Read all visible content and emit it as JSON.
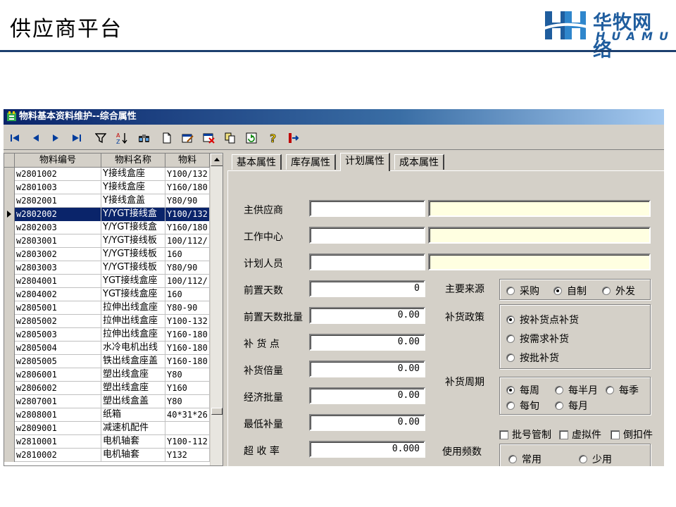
{
  "slide": {
    "title": "供应商平台"
  },
  "logo": {
    "cn": "华牧网络",
    "en": "HUAMU"
  },
  "window": {
    "title": "物料基本资料维护--综合属性",
    "toolbar": [
      "first-record-icon",
      "prev-record-icon",
      "next-record-icon",
      "last-record-icon",
      "filter-icon",
      "sort-icon",
      "find-icon",
      "new-icon",
      "edit-icon",
      "delete-icon",
      "copy-icon",
      "refresh-icon",
      "help-icon",
      "exit-icon"
    ]
  },
  "grid": {
    "columns": [
      "物料编号",
      "物料名称",
      "物料"
    ],
    "selected_index": 3,
    "rows": [
      [
        "w2801002",
        "Y接线盒座",
        "Y100/132"
      ],
      [
        "w2801003",
        "Y接线盒座",
        "Y160/180"
      ],
      [
        "w2802001",
        "Y接线盒盖",
        "Y80/90"
      ],
      [
        "w2802002",
        "Y/YGT接线盒",
        "Y100/132"
      ],
      [
        "w2802003",
        "Y/YGT接线盒",
        "Y160/180"
      ],
      [
        "w2803001",
        "Y/YGT接线板",
        "100/112/"
      ],
      [
        "w2803002",
        "Y/YGT接线板",
        "160"
      ],
      [
        "w2803003",
        "Y/YGT接线板",
        "Y80/90"
      ],
      [
        "w2804001",
        "YGT接线盒座",
        "100/112/"
      ],
      [
        "w2804002",
        "YGT接线盒座",
        "160"
      ],
      [
        "w2805001",
        "拉伸出线盒座",
        "Y80-90"
      ],
      [
        "w2805002",
        "拉伸出线盒座",
        "Y100-132"
      ],
      [
        "w2805003",
        "拉伸出线盒座",
        "Y160-180"
      ],
      [
        "w2805004",
        "水冷电机出线",
        "Y160-180"
      ],
      [
        "w2805005",
        "铁出线盒座盖",
        "Y160-180"
      ],
      [
        "w2806001",
        "塑出线盒座",
        "Y80"
      ],
      [
        "w2806002",
        "塑出线盒座",
        "Y160"
      ],
      [
        "w2807001",
        "塑出线盒盖",
        "Y80"
      ],
      [
        "w2808001",
        "纸箱",
        "40*31*26"
      ],
      [
        "w2809001",
        "减速机配件",
        ""
      ],
      [
        "w2810001",
        "电机轴套",
        "Y100-112"
      ],
      [
        "w2810002",
        "电机轴套",
        "Y132"
      ]
    ]
  },
  "tabs": [
    "基本属性",
    "库存属性",
    "计划属性",
    "成本属性"
  ],
  "active_tab": "计划属性",
  "form": {
    "main_supplier": {
      "label": "主供应商",
      "code": "",
      "name": ""
    },
    "work_center": {
      "label": "工作中心",
      "code": "",
      "name": ""
    },
    "planner": {
      "label": "计划人员",
      "code": "",
      "name": ""
    },
    "lead_days": {
      "label": "前置天数",
      "value": "0"
    },
    "lead_days_batch": {
      "label": "前置天数批量",
      "value": "0.00"
    },
    "reorder_point": {
      "label": "补 货 点",
      "value": "0.00"
    },
    "reorder_multiple": {
      "label": "补货倍量",
      "value": "0.00"
    },
    "economic_batch": {
      "label": "经济批量",
      "value": "0.00"
    },
    "min_reorder": {
      "label": "最低补量",
      "value": "0.00"
    },
    "overrun_rate": {
      "label": "超 收 率",
      "value": "0.000"
    },
    "source": {
      "label": "主要来源",
      "options": [
        "采购",
        "自制",
        "外发"
      ],
      "selected": "自制"
    },
    "policy": {
      "label": "补货政策",
      "options": [
        "按补货点补货",
        "按需求补货",
        "按批补货"
      ],
      "selected": "按补货点补货"
    },
    "cycle": {
      "label": "补货周期",
      "options": [
        "每周",
        "每半月",
        "每季",
        "每旬",
        "每月"
      ],
      "selected": "每周"
    },
    "checks": {
      "batch_control": "批号管制",
      "virtual_part": "虚拟件",
      "backflush": "倒扣件"
    },
    "frequency": {
      "label": "使用频数",
      "options": [
        "常用",
        "少用"
      ],
      "selected": ""
    }
  }
}
